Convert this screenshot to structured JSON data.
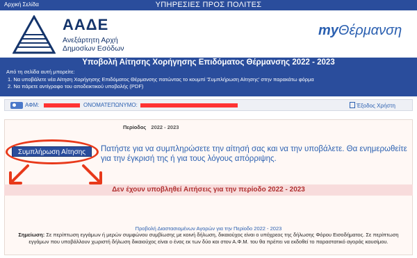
{
  "topbar": {
    "home_link": "Αρχική Σελίδα",
    "services_title": "ΥΠΗΡΕΣΙΕΣ ΠΡΟΣ ΠΟΛΙΤΕΣ"
  },
  "brand": {
    "org_abbr": "ΑΑΔΕ",
    "org_line1": "Ανεξάρτητη Αρχή",
    "org_line2": "Δημοσίων Εσόδων",
    "app_prefix": "my",
    "app_name": "Θέρμανση"
  },
  "page_title": "Υποβολή Αίτησης Χορήγησης Επιδόματος Θέρμανσης 2022 - 2023",
  "info": {
    "intro": "Από τη σελίδα αυτή μπορείτε:",
    "items": [
      "1. Να υποβάλετε νέα Αίτηση Χορήγησης Επιδόματος Θέρμανσης πατώντας το κουμπί 'Συμπλήρωση Αίτησης' στην παρακάτω φόρμα",
      "2. Να πάρετε αντίγραφο του αποδεικτικού υποβολής (PDF)"
    ]
  },
  "userbar": {
    "afm_label": "ΑΦΜ:",
    "name_label": "ΟΝΟΜΑΤΕΠΩΝΥΜΟ:",
    "logout_label": "Έξοδος Χρήστη"
  },
  "form": {
    "period_label": "Περίοδος",
    "period_value": "2022 - 2023",
    "apply_button": "Συμπλήρωση Αίτησης",
    "instructions": "Πατήστε για να συμπληρώσετε την αίτησή σας και να την υποβάλετε. Θα ενημερωθείτε για την έγκρισή της ή για τους λόγους απόρριψης.",
    "no_applications": "Δεν έχουν υποβληθεί Αιτήσεις για την περίοδο 2022 - 2023"
  },
  "footer": {
    "title": "Προβολή Διαστασιομένων Αγορών για την Περίοδο 2022 - 2023",
    "note_label": "Σημείωση:",
    "note_text": "Σε περίπτωση εγγάμων ή μερών συμφώνου συμβίωσης με κοινή δήλωση, δικαιούχος είναι ο υπόχρεος της δήλωσης Φόρου Εισοδήματος. Σε περίπτωση εγγάμων που υποβάλλουν χωριστή δήλωση δικαιούχος είναι ο ένας εκ των δύο και στον Α.Φ.Μ. του θα πρέπει να εκδοθεί το παραστατικό αγοράς καυσίμου."
  },
  "colors": {
    "primary_blue": "#2a4d9c",
    "annotation_red": "#e8391a",
    "redaction_red": "#ff3333",
    "alert_bg": "#f8dcdc"
  }
}
